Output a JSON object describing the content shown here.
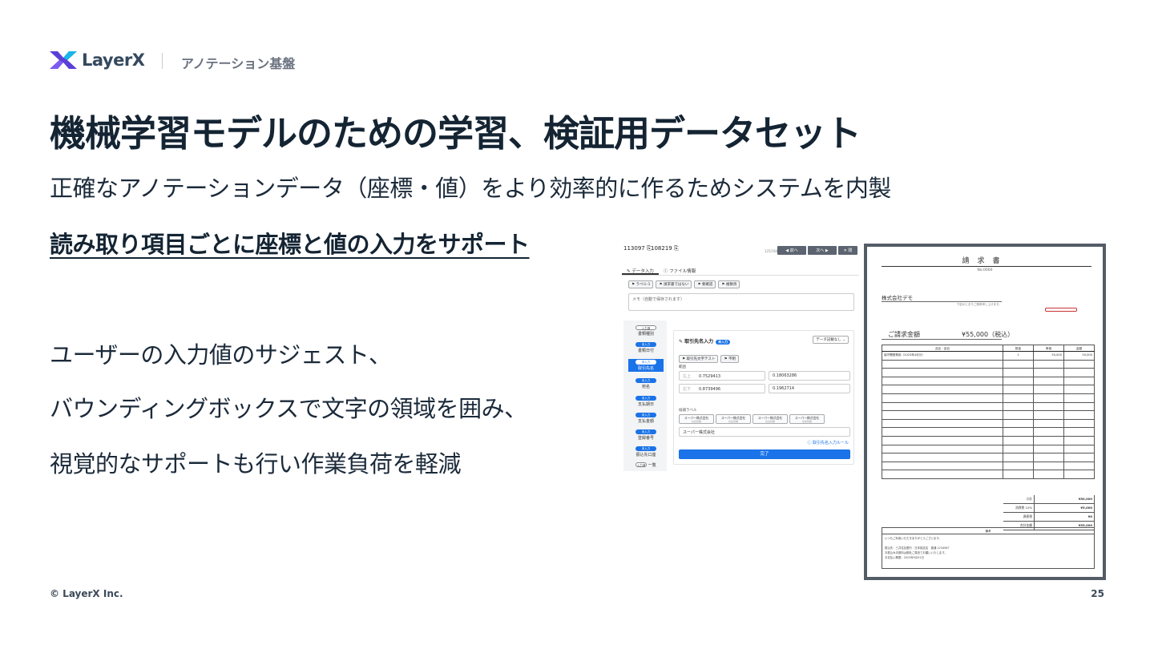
{
  "header": {
    "brand": "LayerX",
    "product": "アノテーション基盤"
  },
  "slide": {
    "title": "機械学習モデルのための学習、検証用データセット",
    "subtitle": "正確なアノテーションデータ（座標・値）をより効率的に作るためシステムを内製",
    "section_heading": "読み取り項目ごとに座標と値の入力をサポート",
    "bullets": [
      "ユーザーの入力値のサジェスト、",
      "バウンディングボックスで文字の領域を囲み、",
      "視覚的なサポートも行い作業負荷を軽減"
    ]
  },
  "footer": {
    "copyright": "© LayerX Inc.",
    "page_number": "25"
  },
  "tool": {
    "doc_id": "113097",
    "doc_id2": "108219",
    "nav_prev": "◀ 前へ",
    "nav_next": "次へ ▶",
    "nav_close": "✕ 閉",
    "counter": "125/164",
    "tabs": [
      "データ入力",
      "ファイル情報"
    ],
    "tags": [
      "ラベル-1",
      "請求書ではない",
      "要確認",
      "複数頁"
    ],
    "memo_placeholder": "メモ（自動で保存されます）",
    "fields": [
      {
        "badge": "入力済",
        "label": "書類種別",
        "outline": true
      },
      {
        "badge": "未入力",
        "label": "書類日付"
      },
      {
        "badge": "未入力",
        "label": "取引先名",
        "active": true
      },
      {
        "badge": "未入力",
        "label": "宛名"
      },
      {
        "badge": "未入力",
        "label": "支払期日"
      },
      {
        "badge": "未入力",
        "label": "支払金額"
      },
      {
        "badge": "未入力",
        "label": "登録番号"
      },
      {
        "badge": "未入力",
        "label": "振込先口座"
      },
      {
        "badge": "入力済",
        "label": "一覧",
        "outline": true
      }
    ],
    "panel": {
      "title": "取引先名入力",
      "status": "未入力",
      "dataset_button": "データ記載なし",
      "tags": [
        "取引先文字テスト",
        "不明"
      ],
      "range_label": "範囲",
      "x_prefix": "左上",
      "y_prefix": "右下",
      "coords": [
        "0.7529413",
        "0.18063286",
        "0.8739496",
        "0.1962714"
      ],
      "candidate_label": "候補ラベル",
      "candidates": [
        {
          "name": "スーパー株式会社",
          "sub": "社名候補"
        },
        {
          "name": "スーパー株式会社",
          "sub": "社名候補"
        },
        {
          "name": "スーパー株式会社",
          "sub": "社名候補"
        },
        {
          "name": "スーパー株式会社",
          "sub": "住所候補"
        }
      ],
      "value": "スーパー株式会社",
      "rule_link": "取引先名入力ルール",
      "done_button": "完了"
    }
  },
  "invoice": {
    "title": "請求書",
    "number": "No.0000",
    "customer": "株式会社デモ",
    "note": "下記のとおりご請求申し上げます。",
    "total_label": "ご請求金額",
    "total_value": "¥55,000（税込）",
    "columns": [
      "品名・品目",
      "数量",
      "単価",
      "金額"
    ],
    "rows": [
      [
        "保守開発費用（2023年4月分）",
        "1",
        "50,000",
        "50,000"
      ]
    ],
    "empty_rows": 14,
    "summary": [
      {
        "label": "小計",
        "value": "¥50,000"
      },
      {
        "label": "消費税 10%",
        "value": "¥5,000"
      },
      {
        "label": "源泉税",
        "value": "¥0"
      },
      {
        "label": "合計金額",
        "value": "¥55,000"
      }
    ],
    "remarks_label": "備考",
    "remarks_lines": [
      "いつもご利用いただきありがとうございます。",
      "",
      "振込先：三井住友銀行　日本橋支店　普通 1234567",
      "お振込み手数料は御社ご負担でお願いいたします。",
      "お支払い期限：2023年5月31日"
    ]
  },
  "colors": {
    "title_text": "#142433",
    "accent_blue": "#1a73e8",
    "logo_purple": "#5b3fd6",
    "logo_cyan": "#19b6e8"
  }
}
